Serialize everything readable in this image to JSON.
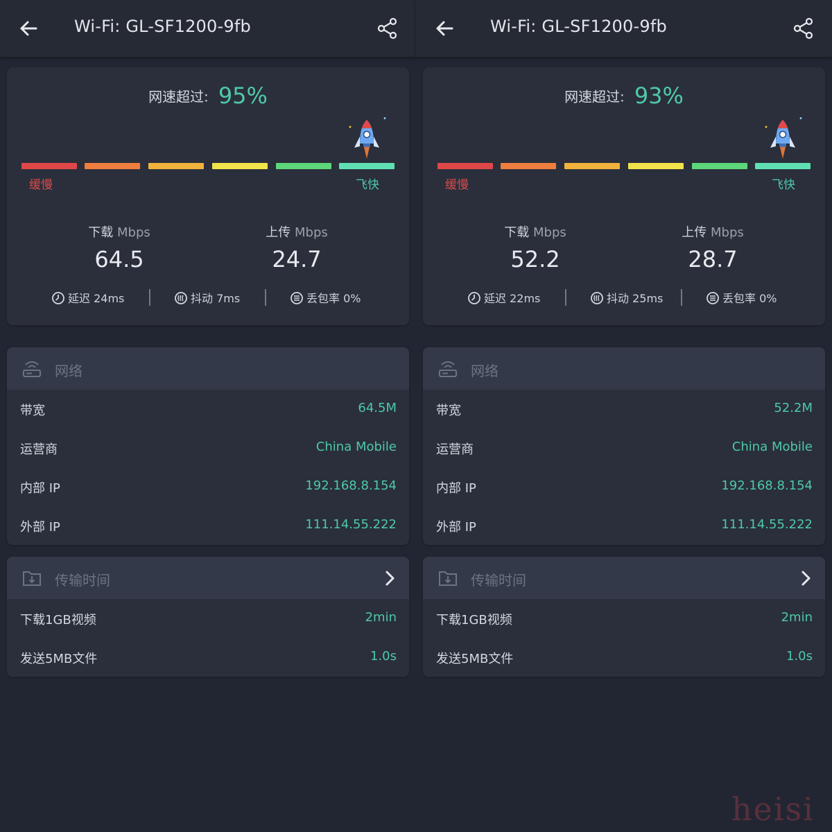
{
  "panes": [
    {
      "title": "Wi-Fi: GL-SF1200-9fb",
      "percent_label": "网速超过:",
      "percent_value": "95%",
      "rocket_level": 1.0,
      "scale_slow": "缓慢",
      "scale_fast": "飞快",
      "download_label": "下载",
      "download_unit": "Mbps",
      "download_value": "64.5",
      "upload_label": "上传",
      "upload_unit": "Mbps",
      "upload_value": "24.7",
      "latency_label": "延迟",
      "latency_value": "24ms",
      "jitter_label": "抖动",
      "jitter_value": "7ms",
      "loss_label": "丢包率",
      "loss_value": "0%",
      "network_title": "网络",
      "network_rows": [
        {
          "label": "带宽",
          "value": "64.5M"
        },
        {
          "label": "运营商",
          "value": "China Mobile"
        },
        {
          "label": "内部 IP",
          "value": "192.168.8.154"
        },
        {
          "label": "外部 IP",
          "value": "111.14.55.222"
        }
      ],
      "transfer_title": "传输时间",
      "transfer_rows": [
        {
          "label": "下载1GB视频",
          "value": "2min"
        },
        {
          "label": "发送5MB文件",
          "value": "1.0s"
        }
      ]
    },
    {
      "title": "Wi-Fi: GL-SF1200-9fb",
      "percent_label": "网速超过:",
      "percent_value": "93%",
      "rocket_level": 1.0,
      "scale_slow": "缓慢",
      "scale_fast": "飞快",
      "download_label": "下载",
      "download_unit": "Mbps",
      "download_value": "52.2",
      "upload_label": "上传",
      "upload_unit": "Mbps",
      "upload_value": "28.7",
      "latency_label": "延迟",
      "latency_value": "22ms",
      "jitter_label": "抖动",
      "jitter_value": "25ms",
      "loss_label": "丢包率",
      "loss_value": "0%",
      "network_title": "网络",
      "network_rows": [
        {
          "label": "带宽",
          "value": "52.2M"
        },
        {
          "label": "运营商",
          "value": "China Mobile"
        },
        {
          "label": "内部 IP",
          "value": "192.168.8.154"
        },
        {
          "label": "外部 IP",
          "value": "111.14.55.222"
        }
      ],
      "transfer_title": "传输时间",
      "transfer_rows": [
        {
          "label": "下载1GB视频",
          "value": "2min"
        },
        {
          "label": "发送5MB文件",
          "value": "1.0s"
        }
      ]
    }
  ],
  "scale_colors": [
    "#e04848",
    "#ef7f3e",
    "#f2b33d",
    "#f2e34a",
    "#5ed67a",
    "#5fe0b4"
  ],
  "accent_color": "#4fc9a6",
  "icons": {
    "back": "arrow-left-icon",
    "share": "share-icon",
    "rocket": "rocket-icon",
    "latency": "latency-icon",
    "jitter": "jitter-icon",
    "loss": "packet-loss-icon",
    "network": "router-icon",
    "transfer": "folder-download-icon",
    "chevron": "chevron-right-icon"
  },
  "watermark": "heisi"
}
